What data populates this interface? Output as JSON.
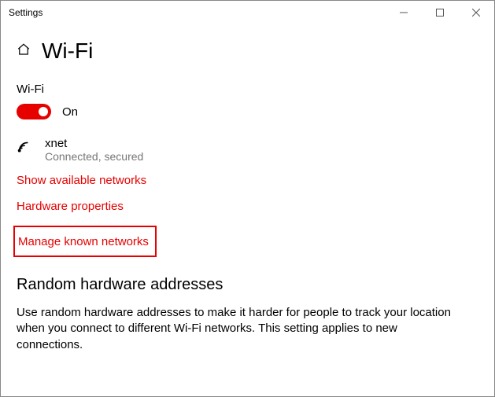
{
  "window": {
    "title": "Settings"
  },
  "header": {
    "title": "Wi-Fi"
  },
  "wifi": {
    "label": "Wi-Fi",
    "toggle_state": "On"
  },
  "connection": {
    "ssid": "xnet",
    "status": "Connected, secured"
  },
  "links": {
    "show_available": "Show available networks",
    "hardware_properties": "Hardware properties",
    "manage_known": "Manage known networks"
  },
  "random_mac": {
    "heading": "Random hardware addresses",
    "body": "Use random hardware addresses to make it harder for people to track your location when you connect to different Wi-Fi networks. This setting applies to new connections."
  },
  "colors": {
    "accent": "#e60000"
  }
}
